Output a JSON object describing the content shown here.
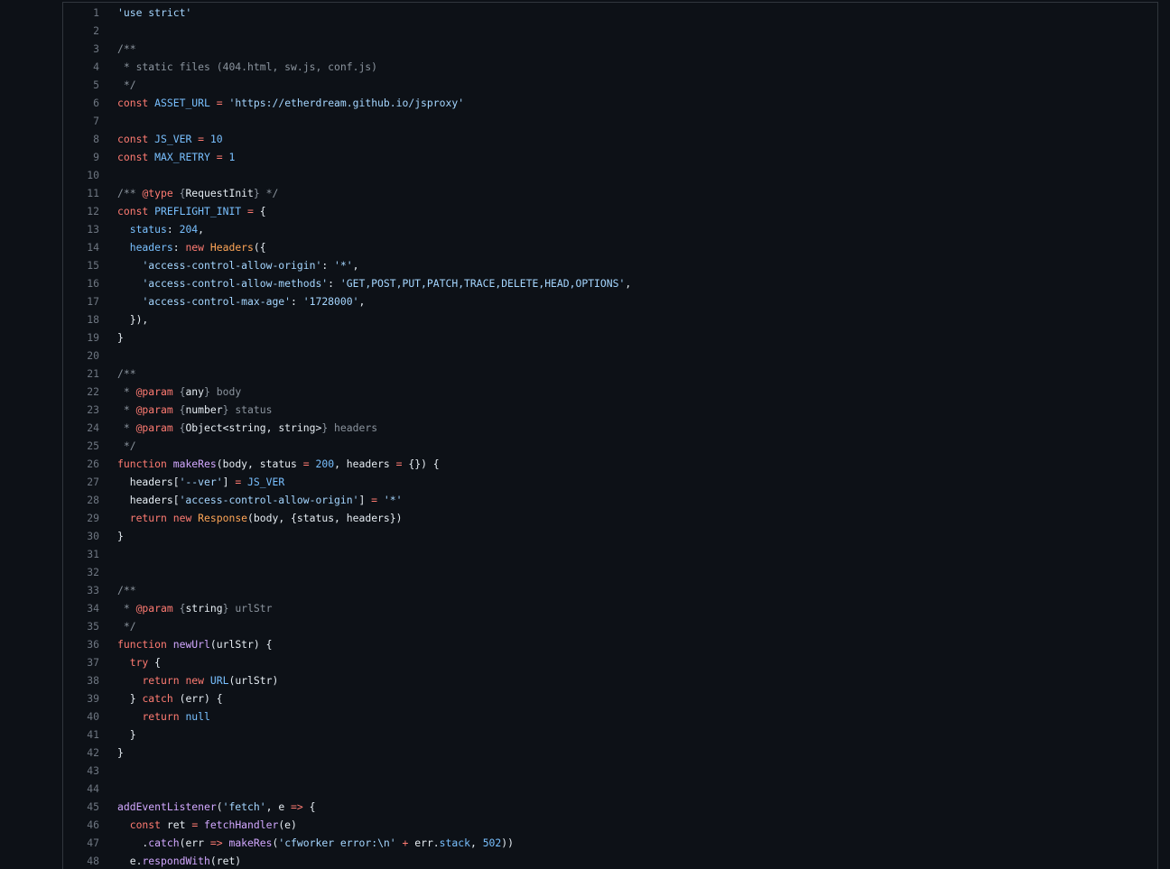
{
  "colors": {
    "background": "#0d1117",
    "border": "#30363d",
    "line_number": "#6e7681",
    "text": "#e6edf3",
    "keyword": "#ff7b72",
    "string": "#a5d6ff",
    "comment": "#8b949e",
    "constant": "#79c0ff",
    "function": "#d2a8ff",
    "class": "#ffa657"
  },
  "lines": [
    {
      "n": "1",
      "tokens": [
        [
          "s",
          "'use strict'"
        ]
      ]
    },
    {
      "n": "2",
      "tokens": []
    },
    {
      "n": "3",
      "tokens": [
        [
          "c",
          "/**"
        ]
      ]
    },
    {
      "n": "4",
      "tokens": [
        [
          "c",
          " * static files (404.html, sw.js, conf.js)"
        ]
      ]
    },
    {
      "n": "5",
      "tokens": [
        [
          "c",
          " */"
        ]
      ]
    },
    {
      "n": "6",
      "tokens": [
        [
          "k",
          "const"
        ],
        [
          "t",
          " "
        ],
        [
          "v",
          "ASSET_URL"
        ],
        [
          "t",
          " "
        ],
        [
          "o",
          "="
        ],
        [
          "t",
          " "
        ],
        [
          "s",
          "'https://etherdream.github.io/jsproxy'"
        ]
      ]
    },
    {
      "n": "7",
      "tokens": []
    },
    {
      "n": "8",
      "tokens": [
        [
          "k",
          "const"
        ],
        [
          "t",
          " "
        ],
        [
          "v",
          "JS_VER"
        ],
        [
          "t",
          " "
        ],
        [
          "o",
          "="
        ],
        [
          "t",
          " "
        ],
        [
          "n",
          "10"
        ]
      ]
    },
    {
      "n": "9",
      "tokens": [
        [
          "k",
          "const"
        ],
        [
          "t",
          " "
        ],
        [
          "v",
          "MAX_RETRY"
        ],
        [
          "t",
          " "
        ],
        [
          "o",
          "="
        ],
        [
          "t",
          " "
        ],
        [
          "n",
          "1"
        ]
      ]
    },
    {
      "n": "10",
      "tokens": []
    },
    {
      "n": "11",
      "tokens": [
        [
          "c",
          "/** "
        ],
        [
          "k",
          "@type"
        ],
        [
          "c",
          " {"
        ],
        [
          "t",
          "RequestInit"
        ],
        [
          "c",
          "} */"
        ]
      ]
    },
    {
      "n": "12",
      "tokens": [
        [
          "k",
          "const"
        ],
        [
          "t",
          " "
        ],
        [
          "v",
          "PREFLIGHT_INIT"
        ],
        [
          "t",
          " "
        ],
        [
          "o",
          "="
        ],
        [
          "t",
          " {"
        ]
      ]
    },
    {
      "n": "13",
      "tokens": [
        [
          "t",
          "  "
        ],
        [
          "v",
          "status"
        ],
        [
          "t",
          ": "
        ],
        [
          "n",
          "204"
        ],
        [
          "t",
          ","
        ]
      ]
    },
    {
      "n": "14",
      "tokens": [
        [
          "t",
          "  "
        ],
        [
          "v",
          "headers"
        ],
        [
          "t",
          ": "
        ],
        [
          "k",
          "new"
        ],
        [
          "t",
          " "
        ],
        [
          "x",
          "Headers"
        ],
        [
          "t",
          "({"
        ]
      ]
    },
    {
      "n": "15",
      "tokens": [
        [
          "t",
          "    "
        ],
        [
          "s",
          "'access-control-allow-origin'"
        ],
        [
          "t",
          ": "
        ],
        [
          "s",
          "'*'"
        ],
        [
          "t",
          ","
        ]
      ]
    },
    {
      "n": "16",
      "tokens": [
        [
          "t",
          "    "
        ],
        [
          "s",
          "'access-control-allow-methods'"
        ],
        [
          "t",
          ": "
        ],
        [
          "s",
          "'GET,POST,PUT,PATCH,TRACE,DELETE,HEAD,OPTIONS'"
        ],
        [
          "t",
          ","
        ]
      ]
    },
    {
      "n": "17",
      "tokens": [
        [
          "t",
          "    "
        ],
        [
          "s",
          "'access-control-max-age'"
        ],
        [
          "t",
          ": "
        ],
        [
          "s",
          "'1728000'"
        ],
        [
          "t",
          ","
        ]
      ]
    },
    {
      "n": "18",
      "tokens": [
        [
          "t",
          "  }),"
        ]
      ]
    },
    {
      "n": "19",
      "tokens": [
        [
          "t",
          "}"
        ]
      ]
    },
    {
      "n": "20",
      "tokens": []
    },
    {
      "n": "21",
      "tokens": [
        [
          "c",
          "/**"
        ]
      ]
    },
    {
      "n": "22",
      "tokens": [
        [
          "c",
          " * "
        ],
        [
          "k",
          "@param"
        ],
        [
          "c",
          " {"
        ],
        [
          "t",
          "any"
        ],
        [
          "c",
          "} body"
        ]
      ]
    },
    {
      "n": "23",
      "tokens": [
        [
          "c",
          " * "
        ],
        [
          "k",
          "@param"
        ],
        [
          "c",
          " {"
        ],
        [
          "t",
          "number"
        ],
        [
          "c",
          "} status"
        ]
      ]
    },
    {
      "n": "24",
      "tokens": [
        [
          "c",
          " * "
        ],
        [
          "k",
          "@param"
        ],
        [
          "c",
          " {"
        ],
        [
          "t",
          "Object<string, string>"
        ],
        [
          "c",
          "} headers"
        ]
      ]
    },
    {
      "n": "25",
      "tokens": [
        [
          "c",
          " */"
        ]
      ]
    },
    {
      "n": "26",
      "tokens": [
        [
          "k",
          "function"
        ],
        [
          "t",
          " "
        ],
        [
          "f",
          "makeRes"
        ],
        [
          "t",
          "(body, status "
        ],
        [
          "o",
          "="
        ],
        [
          "t",
          " "
        ],
        [
          "n",
          "200"
        ],
        [
          "t",
          ", headers "
        ],
        [
          "o",
          "="
        ],
        [
          "t",
          " {}) {"
        ]
      ]
    },
    {
      "n": "27",
      "tokens": [
        [
          "t",
          "  headers["
        ],
        [
          "s",
          "'--ver'"
        ],
        [
          "t",
          "] "
        ],
        [
          "o",
          "="
        ],
        [
          "t",
          " "
        ],
        [
          "v",
          "JS_VER"
        ]
      ]
    },
    {
      "n": "28",
      "tokens": [
        [
          "t",
          "  headers["
        ],
        [
          "s",
          "'access-control-allow-origin'"
        ],
        [
          "t",
          "] "
        ],
        [
          "o",
          "="
        ],
        [
          "t",
          " "
        ],
        [
          "s",
          "'*'"
        ]
      ]
    },
    {
      "n": "29",
      "tokens": [
        [
          "t",
          "  "
        ],
        [
          "k",
          "return"
        ],
        [
          "t",
          " "
        ],
        [
          "k",
          "new"
        ],
        [
          "t",
          " "
        ],
        [
          "x",
          "Response"
        ],
        [
          "t",
          "(body, {status, headers})"
        ]
      ]
    },
    {
      "n": "30",
      "tokens": [
        [
          "t",
          "}"
        ]
      ]
    },
    {
      "n": "31",
      "tokens": []
    },
    {
      "n": "32",
      "tokens": []
    },
    {
      "n": "33",
      "tokens": [
        [
          "c",
          "/**"
        ]
      ]
    },
    {
      "n": "34",
      "tokens": [
        [
          "c",
          " * "
        ],
        [
          "k",
          "@param"
        ],
        [
          "c",
          " {"
        ],
        [
          "t",
          "string"
        ],
        [
          "c",
          "} urlStr"
        ]
      ]
    },
    {
      "n": "35",
      "tokens": [
        [
          "c",
          " */"
        ]
      ]
    },
    {
      "n": "36",
      "tokens": [
        [
          "k",
          "function"
        ],
        [
          "t",
          " "
        ],
        [
          "f",
          "newUrl"
        ],
        [
          "t",
          "(urlStr) {"
        ]
      ]
    },
    {
      "n": "37",
      "tokens": [
        [
          "t",
          "  "
        ],
        [
          "k",
          "try"
        ],
        [
          "t",
          " {"
        ]
      ]
    },
    {
      "n": "38",
      "tokens": [
        [
          "t",
          "    "
        ],
        [
          "k",
          "return"
        ],
        [
          "t",
          " "
        ],
        [
          "k",
          "new"
        ],
        [
          "t",
          " "
        ],
        [
          "v",
          "URL"
        ],
        [
          "t",
          "(urlStr)"
        ]
      ]
    },
    {
      "n": "39",
      "tokens": [
        [
          "t",
          "  } "
        ],
        [
          "k",
          "catch"
        ],
        [
          "t",
          " (err) {"
        ]
      ]
    },
    {
      "n": "40",
      "tokens": [
        [
          "t",
          "    "
        ],
        [
          "k",
          "return"
        ],
        [
          "t",
          " "
        ],
        [
          "v",
          "null"
        ]
      ]
    },
    {
      "n": "41",
      "tokens": [
        [
          "t",
          "  }"
        ]
      ]
    },
    {
      "n": "42",
      "tokens": [
        [
          "t",
          "}"
        ]
      ]
    },
    {
      "n": "43",
      "tokens": []
    },
    {
      "n": "44",
      "tokens": []
    },
    {
      "n": "45",
      "tokens": [
        [
          "f",
          "addEventListener"
        ],
        [
          "t",
          "("
        ],
        [
          "s",
          "'fetch'"
        ],
        [
          "t",
          ", e "
        ],
        [
          "o",
          "=>"
        ],
        [
          "t",
          " {"
        ]
      ]
    },
    {
      "n": "46",
      "tokens": [
        [
          "t",
          "  "
        ],
        [
          "k",
          "const"
        ],
        [
          "t",
          " ret "
        ],
        [
          "o",
          "="
        ],
        [
          "t",
          " "
        ],
        [
          "f",
          "fetchHandler"
        ],
        [
          "t",
          "(e)"
        ]
      ]
    },
    {
      "n": "47",
      "tokens": [
        [
          "t",
          "    ."
        ],
        [
          "f",
          "catch"
        ],
        [
          "t",
          "(err "
        ],
        [
          "o",
          "=>"
        ],
        [
          "t",
          " "
        ],
        [
          "f",
          "makeRes"
        ],
        [
          "t",
          "("
        ],
        [
          "s",
          "'cfworker error:\\n'"
        ],
        [
          "t",
          " "
        ],
        [
          "o",
          "+"
        ],
        [
          "t",
          " err."
        ],
        [
          "v",
          "stack"
        ],
        [
          "t",
          ", "
        ],
        [
          "n",
          "502"
        ],
        [
          "t",
          "))"
        ]
      ]
    },
    {
      "n": "48",
      "tokens": [
        [
          "t",
          "  e."
        ],
        [
          "f",
          "respondWith"
        ],
        [
          "t",
          "(ret)"
        ]
      ]
    }
  ]
}
